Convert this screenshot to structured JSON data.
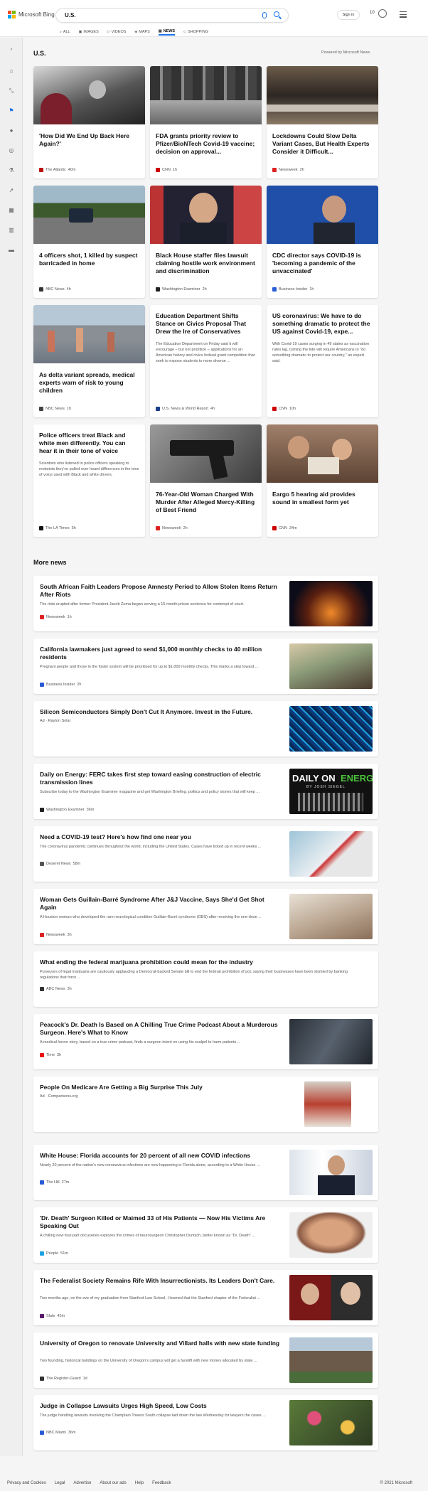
{
  "header": {
    "brand": "Microsoft Bing",
    "query": "U.S.",
    "signin": "Sign in",
    "rewards_points": "10",
    "tabs": [
      {
        "label": "ALL",
        "icon": "search-icon"
      },
      {
        "label": "IMAGES",
        "icon": "image-icon"
      },
      {
        "label": "VIDEOS",
        "icon": "video-icon"
      },
      {
        "label": "MAPS",
        "icon": "map-icon"
      },
      {
        "label": "NEWS",
        "icon": "news-icon"
      },
      {
        "label": "SHOPPING",
        "icon": "shopping-icon"
      }
    ],
    "active_tab": "NEWS",
    "accent": "#1a73e8"
  },
  "topics": {
    "title": "U.S.",
    "powered_by": "Powered by Microsoft News",
    "cards": [
      {
        "title": "'How Did We End Up Back Here Again?'",
        "source": "The Atlantic",
        "time": "40m",
        "color": "#b11"
      },
      {
        "title": "FDA grants priority review to Pfizer/BioNTech Covid-19 vaccine; decision on approval...",
        "source": "CNN",
        "time": "1h",
        "color": "#c00"
      },
      {
        "title": "Lockdowns Could Slow Delta Variant Cases, But Health Experts Consider it Difficult...",
        "source": "Newsweek",
        "time": "2h",
        "color": "#d22"
      },
      {
        "title": "4 officers shot, 1 killed by suspect barricaded in home",
        "source": "ABC News",
        "time": "4h",
        "color": "#333"
      },
      {
        "title": "Black House staffer files lawsuit claiming hostile work environment and discrimination",
        "source": "Washington Examiner",
        "time": "2h",
        "color": "#222"
      },
      {
        "title": "CDC director says COVID-19 is 'becoming a pandemic of the unvaccinated'",
        "source": "Business Insider",
        "time": "1h",
        "color": "#2a5bd7"
      },
      {
        "title": "As delta variant spreads, medical experts warn of risk to young children",
        "source": "NBC News",
        "time": "1h",
        "color": "#444"
      },
      {
        "title": "Education Department Shifts Stance on Civics Proposal That Drew the Ire of Conservatives",
        "abstract": "The Education Department on Friday said it will encourage – but not prioritize – applications for an American history and civics federal grant competition that seek to expose students to more diverse ...",
        "source": "U.S. News & World Report",
        "time": "4h",
        "color": "#1b3f8b"
      },
      {
        "title": "US coronavirus: We have to do something dramatic to protect the US against Covid-19, expe...",
        "abstract": "With Covid-19 cases surging in 49 states as vaccination rates lag, turning the tide will require Americans to \"do something dramatic to protect our country,\" an expert said.",
        "source": "CNN",
        "time": "10h",
        "color": "#c00"
      },
      {
        "title": "Police officers treat Black and white men differently. You can hear it in their tone of voice",
        "abstract": "Scientists who listened to police officers speaking to motorists they've pulled over heard differences in the tone of voice used with Black and white drivers.",
        "source": "The LA Times",
        "time": "5h",
        "color": "#111"
      },
      {
        "title": "76-Year-Old Woman Charged With Murder After Alleged Mercy-Killing of Best Friend",
        "source": "Newsweek",
        "time": "2h",
        "color": "#d22"
      },
      {
        "title": "Eargo 5 hearing aid provides sound in smallest form yet",
        "source": "CNN",
        "time": "34m",
        "color": "#c00"
      }
    ]
  },
  "more_news": {
    "title": "More news",
    "items": [
      {
        "title": "South African Faith Leaders Propose Amnesty Period to Allow Stolen Items Return After Riots",
        "snippet": "The riots erupted after former President Jacob Zuma began serving a 15-month prison sentence for contempt of court.",
        "source": "Newsweek",
        "time": "1h",
        "color": "#d22"
      },
      {
        "title": "California lawmakers just agreed to send $1,000 monthly checks to 40 million residents",
        "snippet": "Pregnant people and those in the foster system will be prioritized for up to $1,000 monthly checks. This marks a step toward ...",
        "source": "Business Insider",
        "time": "2h",
        "color": "#2a5bd7"
      },
      {
        "title": "Silicon Semiconductors Simply Don't Cut It Anymore. Invest in the Future.",
        "snippet": "",
        "source": "Ad · Rayton Solar",
        "time": "",
        "color": ""
      },
      {
        "title": "Daily on Energy: FERC takes first step toward easing construction of electric transmission lines",
        "snippet": "Subscribe today to the Washington Examiner magazine and get Washington Briefing: politics and policy stories that will keep ...",
        "source": "Washington Examiner",
        "time": "36m",
        "color": "#222",
        "thumb_text_1": "DAILY ON",
        "thumb_text_2": "ENERG",
        "thumb_text_3": "BY JOSH SIEGEL"
      },
      {
        "title": "Need a COVID-19 test? Here's how find one near you",
        "snippet": "The coronavirus pandemic continues throughout the world, including the United States. Cases have ticked up in recent weeks ...",
        "source": "Deseret News",
        "time": "58m",
        "color": "#555"
      },
      {
        "title": "Woman Gets Guillain-Barré Syndrome After J&J Vaccine, Says She'd Get Shot Again",
        "snippet": "A Houston woman who developed the rare neurological condition Guillain-Barré syndrome (GBS) after receiving the one-dose ...",
        "source": "Newsweek",
        "time": "3h",
        "color": "#d22"
      },
      {
        "title": "What ending the federal marijuana prohibition could mean for the industry",
        "snippet": "Purveyors of legal marijuana are cautiously applauding a Democrat-backed Senate bill to end the federal prohibition of pot, saying their businesses have been stymied by banking regulations that force ...",
        "source": "ABC News",
        "time": "3h",
        "color": "#333"
      },
      {
        "title": "Peacock's Dr. Death Is Based on A Chilling True Crime Podcast About a Murderous Surgeon. Here's What to Know",
        "snippet": "A medical horror story, based on a true crime podcast, finds a surgeon intent on using his scalpel to harm patients ...",
        "source": "Time",
        "time": "3h",
        "color": "#e11"
      },
      {
        "title": "People On Medicare Are Getting a Big Surprise This July",
        "snippet": "",
        "source": "Ad · Comparisons.org",
        "time": "",
        "color": ""
      },
      {
        "title": "White House: Florida accounts for 20 percent of all new COVID infections",
        "snippet": "Nearly 20 percent of the nation's new coronavirus infections are now happening in Florida alone, according to a White House ...",
        "source": "The Hill",
        "time": "27m",
        "color": "#2a5bd7"
      },
      {
        "title": "'Dr. Death' Surgeon Killed or Maimed 33 of His Patients — Now His Victims Are Speaking Out",
        "snippet": "A chilling new four-part docuseries explores the crimes of neurosurgeon Christopher Duntsch, better known as \"Dr. Death\" ...",
        "source": "People",
        "time": "51m",
        "color": "#1aa3e0"
      },
      {
        "title": "The Federalist Society Remains Rife With Insurrectionists. Its Leaders Don't Care.",
        "snippet": "Two months ago, on the eve of my graduation from Stanford Law School, I learned that the Stanford chapter of the Federalist ...",
        "source": "Slate",
        "time": "45m",
        "color": "#5a1a6a"
      },
      {
        "title": "University of Oregon to renovate University and Villard halls with new state funding",
        "snippet": "Two founding, historical buildings on the University of Oregon's campus will get a facelift with new money allocated by state ...",
        "source": "The Register-Guard",
        "time": "1d",
        "color": "#333"
      },
      {
        "title": "Judge in Collapse Lawsuits Urges High Speed, Low Costs",
        "snippet": "The judge handling lawsuits involving the Champlain Towers South collapse laid down the law Wednesday for lawyers the cases ...",
        "source": "NBC Miami",
        "time": "36m",
        "color": "#2a5bd7"
      }
    ]
  },
  "footer": {
    "links": [
      "Privacy and Cookies",
      "Legal",
      "Advertise",
      "About our ads",
      "Help",
      "Feedback"
    ],
    "copyright": "© 2021 Microsoft"
  }
}
